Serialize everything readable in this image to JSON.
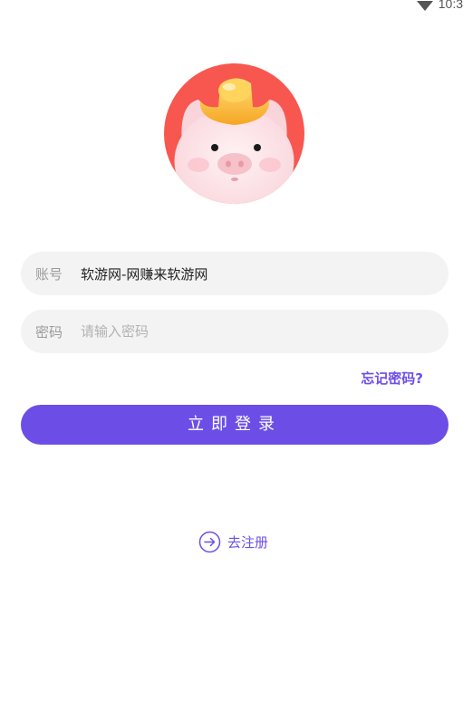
{
  "status_bar": {
    "time": "10:3",
    "wifi_icon": "wifi-icon"
  },
  "avatar": {
    "icon": "piggy-bank-gold-ingot-icon",
    "bg_color": "#f7574f"
  },
  "account": {
    "label": "账号",
    "value": "软游网-网赚来软游网"
  },
  "password": {
    "label": "密码",
    "placeholder": "请输入密码",
    "value": ""
  },
  "forgot_password": "忘记密码?",
  "login_button": "立即登录",
  "register": {
    "label": "去注册",
    "icon": "arrow-right-circle-icon"
  },
  "colors": {
    "accent": "#6c4ee7",
    "field_bg": "#f3f3f3"
  }
}
